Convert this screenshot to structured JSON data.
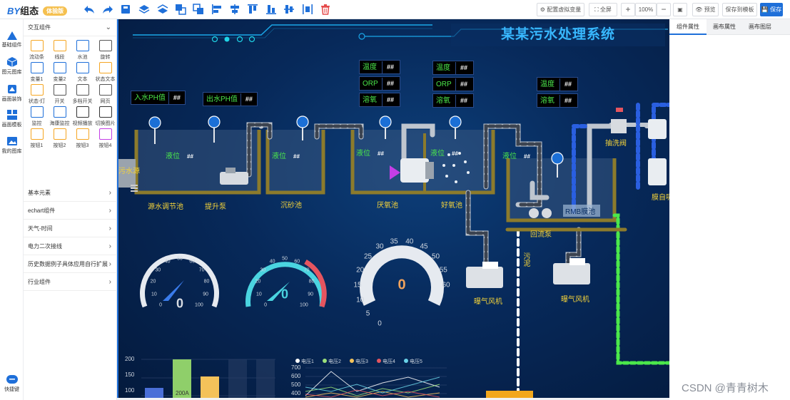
{
  "app": {
    "logo_mark": "BY",
    "logo_name": "组态",
    "logo_badge": "体验版"
  },
  "toolbar": {
    "config_vars": "配置虚拟变量",
    "fullscreen": "全屏",
    "zoom": "100%",
    "preview": "预览",
    "save_template": "保存到模板",
    "save": "保存",
    "colors": {
      "accent": "#1e6fd9",
      "delete": "#e54b4b"
    }
  },
  "rail": {
    "items": [
      {
        "label": "基础组件",
        "icon": "triangle-icon"
      },
      {
        "label": "图元图库",
        "icon": "cube-icon"
      },
      {
        "label": "画面装饰",
        "icon": "paint-icon"
      },
      {
        "label": "画面模板",
        "icon": "template-icon"
      },
      {
        "label": "我的图库",
        "icon": "image-icon"
      }
    ],
    "shortcut": "快捷键"
  },
  "panel": {
    "open_group": "交互组件",
    "components": [
      {
        "label": "流动条",
        "icon": "flow-bar-icon"
      },
      {
        "label": "线段",
        "icon": "line-icon"
      },
      {
        "label": "水池",
        "icon": "pool-icon"
      },
      {
        "label": "旋转",
        "icon": "rotate-icon"
      },
      {
        "label": "变量1",
        "icon": "variable-icon"
      },
      {
        "label": "变量2",
        "icon": "variable-icon"
      },
      {
        "label": "文本",
        "icon": "text-icon"
      },
      {
        "label": "状态文本",
        "icon": "status-text-icon"
      },
      {
        "label": "状态-灯",
        "icon": "lamp-icon"
      },
      {
        "label": "开关",
        "icon": "switch-icon"
      },
      {
        "label": "多档开关",
        "icon": "multi-switch-icon"
      },
      {
        "label": "网页",
        "icon": "webpage-icon"
      },
      {
        "label": "监控",
        "icon": "camera-icon"
      },
      {
        "label": "海康监控",
        "icon": "camera-icon"
      },
      {
        "label": "视频播放",
        "icon": "video-icon"
      },
      {
        "label": "切换图片",
        "icon": "image-switch-icon"
      },
      {
        "label": "按钮1",
        "icon": "button-icon"
      },
      {
        "label": "按钮2",
        "icon": "button-icon"
      },
      {
        "label": "按钮3",
        "icon": "button-icon"
      },
      {
        "label": "按钮4",
        "icon": "button-icon"
      }
    ],
    "groups": [
      "基本元素",
      "echart组件",
      "天气-时间",
      "电力二次接线",
      "历史数据例子具体应用自行扩展",
      "行业组件"
    ]
  },
  "scene": {
    "title": "某某污水处理系统",
    "sensors": {
      "ph_in": {
        "label": "入水PH值",
        "value": "##"
      },
      "ph_out": {
        "label": "出水PH值",
        "value": "##"
      },
      "anoxic_temp": {
        "label": "温度",
        "value": "##"
      },
      "anoxic_orp": {
        "label": "ORP",
        "value": "##"
      },
      "anoxic_do": {
        "label": "溶氧",
        "value": "##"
      },
      "aerobic_temp": {
        "label": "温度",
        "value": "##"
      },
      "aerobic_orp": {
        "label": "ORP",
        "value": "##"
      },
      "aerobic_do": {
        "label": "溶氧",
        "value": "##"
      },
      "mbr_temp": {
        "label": "温度",
        "value": "##"
      },
      "mbr_do": {
        "label": "溶氧",
        "value": "##"
      }
    },
    "level_label": "液位",
    "level_value": "##",
    "labels": {
      "inlet": "污水源",
      "regulating_tank": "源水调节池",
      "lift_pump": "提升泵",
      "sand_tank": "沉砂池",
      "anoxic_tank": "厌氧池",
      "aerobic_tank": "好氧池",
      "reflux_pump": "回流泵",
      "mbr_tank": "RMB膜池",
      "suction_valve": "抽洗阀",
      "membrane": "膜自吸",
      "sludge": "污泥",
      "blower1": "曝气风机",
      "blower2": "曝气风机"
    },
    "gauges": [
      {
        "value": "0",
        "ticks": [
          "0",
          "10",
          "20",
          "30",
          "40",
          "50",
          "60",
          "70",
          "80",
          "90",
          "100"
        ]
      },
      {
        "value": "0",
        "ticks": [
          "0",
          "10",
          "20",
          "30",
          "40",
          "50",
          "60",
          "70",
          "80",
          "90",
          "100"
        ]
      },
      {
        "value": "0",
        "ticks": [
          "0",
          "5",
          "10",
          "15",
          "20",
          "25",
          "30",
          "35",
          "40",
          "45",
          "50",
          "55",
          "60"
        ]
      }
    ]
  },
  "chart_data": [
    {
      "type": "bar",
      "y_ticks": [
        "200",
        "150",
        "100"
      ],
      "bar_label": "200A",
      "colors": [
        "#4a6fd8",
        "#8fcf6a",
        "#f4c25a",
        "#2a3f66",
        "#2a3f66"
      ]
    },
    {
      "type": "line",
      "y_ticks": [
        "700",
        "600",
        "500",
        "400"
      ],
      "series": [
        {
          "name": "电压1",
          "color": "#ffffff"
        },
        {
          "name": "电压2",
          "color": "#9be07a"
        },
        {
          "name": "电压3",
          "color": "#f4c25a"
        },
        {
          "name": "电压4",
          "color": "#e5555f"
        },
        {
          "name": "电压5",
          "color": "#6ad3e8"
        }
      ]
    }
  ],
  "right_panel": {
    "tabs": [
      "组件属性",
      "画布属性",
      "画布图层"
    ]
  },
  "watermark": "CSDN @青青树木"
}
